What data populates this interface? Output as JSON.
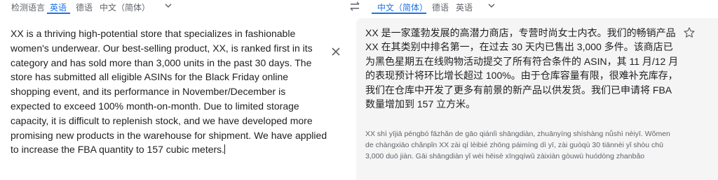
{
  "source_languages": {
    "detect": "检测语言",
    "english": "英语",
    "german": "德语",
    "chinese_simplified": "中文（简体）"
  },
  "target_languages": {
    "chinese_simplified": "中文（简体）",
    "german": "德语",
    "english": "英语"
  },
  "source_text": "XX is a thriving high-potential store that specializes in fashionable women's underwear. Our best-selling product, XX, is ranked first in its category and has sold more than 3,000 units in the past 30 days. The store has submitted all eligible ASINs for the Black Friday online shopping event, and its performance in November/December is expected to exceed 100% month-on-month. Due to limited storage capacity, it is difficult to replenish stock, and we have developed more promising new products in the warehouse for shipment. We have applied to increase the FBA quantity to 157 cubic meters.",
  "translation_text": "XX 是一家蓬勃发展的高潜力商店，专营时尚女士内衣。我们的畅销产品 XX 在其类别中排名第一，在过去 30 天内已售出 3,000 多件。该商店已为黑色星期五在线购物活动提交了所有符合条件的 ASIN，其 11 月/12 月的表现预计将环比增长超过 100%。由于仓库容量有限，很难补充库存，我们在仓库中开发了更多有前景的新产品以供发货。我们已申请将 FBA 数量增加到 157 立方米。",
  "pinyin_text": "XX shì yījiā péngbó fāzhǎn de gāo qiánlì shāngdiàn, zhuānyíng shíshàng nǚshì nèiyī. Wǒmen de chàngxiāo chǎnpǐn XX zài qí lèibié zhōng páimíng dì yī, zài guòqù 30 tiānnèi yǐ shòu chū 3,000 duō jiàn. Gāi shāngdiàn yǐ wèi hēisè xīngqíwǔ zàixiàn gòuwù huódòng zhanbǎo",
  "icons": {
    "chevron_source": "chevron-down-icon",
    "chevron_target": "chevron-down-icon",
    "swap": "swap-arrows-icon",
    "close": "close-icon",
    "star": "star-outline-icon"
  },
  "colors": {
    "accent": "#1a73e8",
    "target_panel": "#f5f5f5"
  }
}
